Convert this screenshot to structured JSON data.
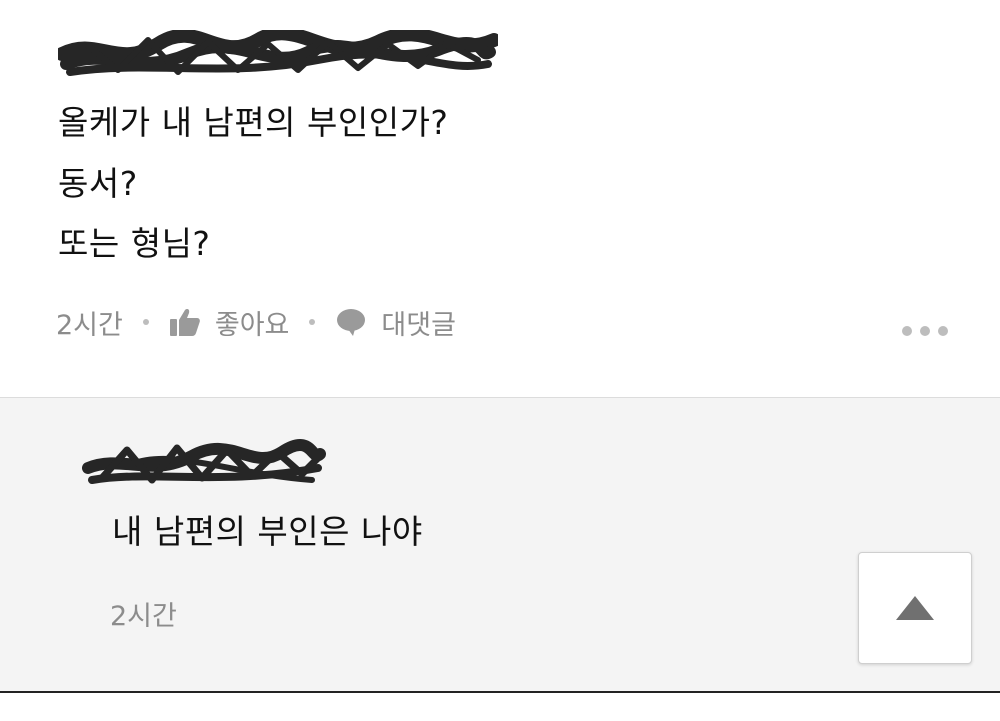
{
  "comment": {
    "lines": [
      "올케가 내 남편의 부인인가?",
      "동서?",
      "또는 형님?"
    ],
    "time": "2시간",
    "like_label": "좋아요",
    "reply_label": "대댓글"
  },
  "reply": {
    "text": "내 남편의 부인은 나야",
    "time": "2시간"
  },
  "colors": {
    "meta_text": "#8c8c8c",
    "reply_bg": "#f4f4f4",
    "redaction": "#262626"
  },
  "icons": {
    "like": "thumbs-up-icon",
    "reply": "speech-bubble-icon",
    "more": "more-dots-icon",
    "scroll_top": "triangle-up-icon"
  }
}
